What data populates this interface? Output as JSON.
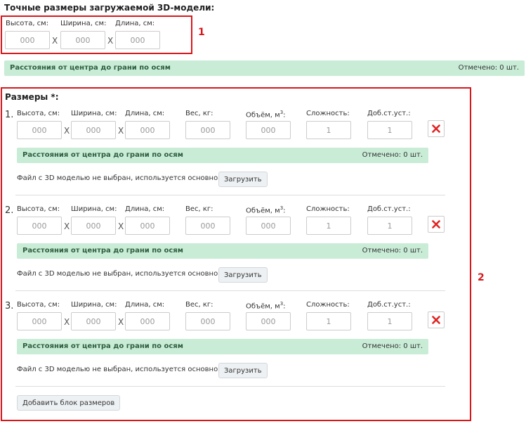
{
  "exact": {
    "title": "Точные размеры загружаемой 3D-модели:",
    "labels": {
      "height": "Высота, см:",
      "width": "Ширина, см:",
      "length": "Длина, см:"
    },
    "placeholder": "000",
    "separator": "X",
    "distance_bar": {
      "label": "Расстояния от центра до грани по осям",
      "marked": "Отмечено: 0 шт."
    },
    "annotation_number": "1"
  },
  "sizes": {
    "title": "Размеры *:",
    "annotation_number": "2",
    "labels": {
      "height": "Высота, см:",
      "width": "Ширина, см:",
      "length": "Длина, см:",
      "weight": "Вес, кг:",
      "volume": "Объём, м",
      "volume_sup": "3",
      "complexity": "Сложность:",
      "extra": "Доб.ст.уст.:"
    },
    "separator": "X",
    "blocks": [
      {
        "number": "1.",
        "placeholders": {
          "height": "000",
          "width": "000",
          "length": "000",
          "weight": "000",
          "volume": "000",
          "complexity": "1",
          "extra": "1"
        },
        "distance_bar": {
          "label": "Расстояния от центра до грани по осям",
          "marked": "Отмечено: 0 шт."
        },
        "file_status": "Файл с 3D моделью не выбран, используется основной",
        "upload_label": "Загрузить"
      },
      {
        "number": "2.",
        "placeholders": {
          "height": "000",
          "width": "000",
          "length": "000",
          "weight": "000",
          "volume": "000",
          "complexity": "1",
          "extra": "1"
        },
        "distance_bar": {
          "label": "Расстояния от центра до грани по осям",
          "marked": "Отмечено: 0 шт."
        },
        "file_status": "Файл с 3D моделью не выбран, используется основной",
        "upload_label": "Загрузить"
      },
      {
        "number": "3.",
        "placeholders": {
          "height": "000",
          "width": "000",
          "length": "000",
          "weight": "000",
          "volume": "000",
          "complexity": "1",
          "extra": "1"
        },
        "distance_bar": {
          "label": "Расстояния от центра до грани по осям",
          "marked": "Отмечено: 0 шт."
        },
        "file_status": "Файл с 3D моделью не выбран, используется основной",
        "upload_label": "Загрузить"
      }
    ],
    "add_block_label": "Добавить блок размеров"
  },
  "colors": {
    "annotation_red": "#d9171b",
    "green_bar": "#c9ecd7",
    "delete_red": "#e02424"
  },
  "icons": {
    "delete": "close-x-icon"
  }
}
